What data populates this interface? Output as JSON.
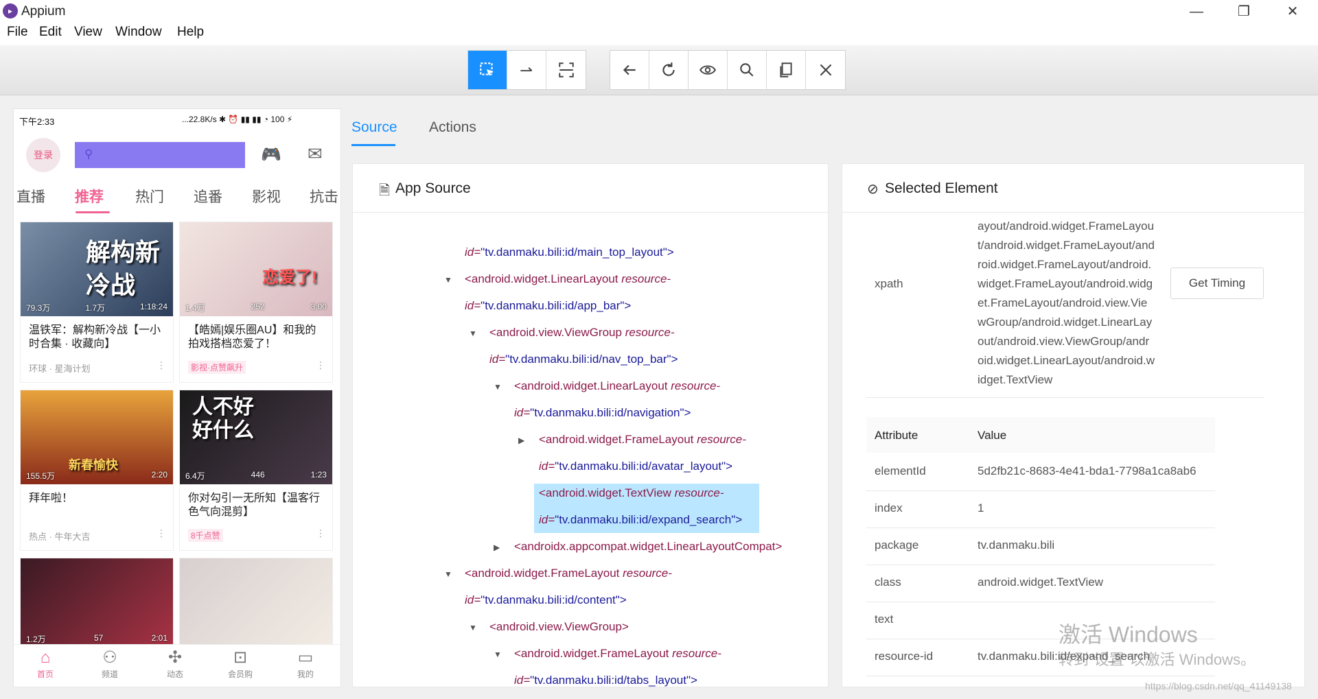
{
  "window": {
    "app_title": "Appium",
    "minimize": "—",
    "maximize": "❐",
    "close": "✕"
  },
  "menu": [
    "File",
    "Edit",
    "View",
    "Window",
    "Help"
  ],
  "toolbar": {
    "group1": [
      "select-element-icon",
      "swipe-icon",
      "screenshot-mode-icon"
    ],
    "group2": [
      "back-icon",
      "refresh-icon",
      "eye-icon",
      "search-icon",
      "copy-icon",
      "quit-icon"
    ]
  },
  "phone": {
    "status_time": "下午2:33",
    "status_right": "...22.8K/s ✱ ⏰ ▮▮ ▮▮ ◔ 100 ⚡",
    "login": "登录",
    "tabs": [
      "直播",
      "推荐",
      "热门",
      "追番",
      "影视",
      "抗击"
    ],
    "active_tab": 1,
    "cards": [
      {
        "title": "温铁军：解构新冷战【一小时合集 · 收藏向】",
        "views": "79.3万",
        "danmaku": "1.7万",
        "duration": "1:18:24",
        "sub": "环球 · 星海计划",
        "overlay": "解构新冷战",
        "badge": ""
      },
      {
        "title": "【皓嫣|娱乐圈AU】和我的拍戏搭档恋爱了！",
        "views": "1.4万",
        "danmaku": "252",
        "duration": "3:00",
        "sub": "",
        "overlay": "恋爱了!",
        "badge": "影视·点赞飙升"
      },
      {
        "title": "拜年啦！",
        "views": "155.5万",
        "danmaku": "",
        "duration": "2:20",
        "sub": "热点 · 牛年大吉",
        "overlay": "新春愉快",
        "badge": ""
      },
      {
        "title": "你对勾引一无所知【温客行色气向混剪】",
        "views": "6.4万",
        "danmaku": "446",
        "duration": "1:23",
        "sub": "",
        "overlay": "人不好 好什么",
        "badge": "8千点赞"
      },
      {
        "title": "",
        "views": "1.2万",
        "danmaku": "57",
        "duration": "2:01",
        "sub": "",
        "overlay": "",
        "badge": ""
      },
      {
        "title": "",
        "views": "",
        "danmaku": "",
        "duration": "",
        "sub": "",
        "overlay": "",
        "badge": ""
      }
    ],
    "bottom_nav": [
      "首页",
      "频道",
      "动态",
      "会员购",
      "我的"
    ]
  },
  "tabs": {
    "source": "Source",
    "actions": "Actions"
  },
  "app_source": {
    "title": "App Source",
    "lines": [
      {
        "indent": 0,
        "caret": "",
        "tag": "",
        "attr": "",
        "id_prefix": "id=",
        "id_val": "\"tv.danmaku.bili:id/main_top_layout\">",
        "part": "second"
      },
      {
        "indent": 0,
        "caret": "▼",
        "tag": "<android.widget.LinearLayout",
        "attr": "resource-",
        "part": "first"
      },
      {
        "indent": 0,
        "caret": "",
        "id_prefix": "id=",
        "id_val": "\"tv.danmaku.bili:id/app_bar\">",
        "part": "second"
      },
      {
        "indent": 1,
        "caret": "▼",
        "tag": "<android.view.ViewGroup",
        "attr": "resource-",
        "part": "first"
      },
      {
        "indent": 1,
        "caret": "",
        "id_prefix": "id=",
        "id_val": "\"tv.danmaku.bili:id/nav_top_bar\">",
        "part": "second"
      },
      {
        "indent": 2,
        "caret": "▼",
        "tag": "<android.widget.LinearLayout",
        "attr": "resource-",
        "part": "first"
      },
      {
        "indent": 2,
        "caret": "",
        "id_prefix": "id=",
        "id_val": "\"tv.danmaku.bili:id/navigation\">",
        "part": "second"
      },
      {
        "indent": 3,
        "caret": "▶",
        "tag": "<android.widget.FrameLayout",
        "attr": "resource-",
        "part": "first"
      },
      {
        "indent": 3,
        "caret": "",
        "id_prefix": "id=",
        "id_val": "\"tv.danmaku.bili:id/avatar_layout\">",
        "part": "second"
      },
      {
        "indent": 3,
        "caret": "",
        "tag": "<android.widget.TextView",
        "attr": "resource-",
        "part": "first"
      },
      {
        "indent": 3,
        "caret": "",
        "id_prefix": "id=",
        "id_val": "\"tv.danmaku.bili:id/expand_search\">",
        "part": "second"
      },
      {
        "indent": 2,
        "caret": "▶",
        "tag": "<androidx.appcompat.widget.LinearLayoutCompat>",
        "attr": "",
        "part": "first"
      },
      {
        "indent": 0,
        "caret": "▼",
        "tag": "<android.widget.FrameLayout",
        "attr": "resource-",
        "part": "first"
      },
      {
        "indent": 0,
        "caret": "",
        "id_prefix": "id=",
        "id_val": "\"tv.danmaku.bili:id/content\">",
        "part": "second"
      },
      {
        "indent": 1,
        "caret": "▼",
        "tag": "<android.view.ViewGroup>",
        "attr": "",
        "part": "first"
      },
      {
        "indent": 2,
        "caret": "▼",
        "tag": "<android.widget.FrameLayout",
        "attr": "resource-",
        "part": "first"
      },
      {
        "indent": 2,
        "caret": "",
        "id_prefix": "id=",
        "id_val": "\"tv.danmaku.bili:id/tabs_layout\">",
        "part": "second"
      }
    ]
  },
  "selected": {
    "title": "Selected Element",
    "xpath_label": "xpath",
    "xpath_value": "ayout/android.widget.FrameLayout/android.widget.FrameLayout/android.widget.FrameLayout/android.widget.FrameLayout/android.widget.FrameLayout/android.view.ViewGroup/android.widget.LinearLayout/android.view.ViewGroup/android.widget.LinearLayout/android.widget.TextView",
    "get_timing": "Get Timing",
    "header_attr": "Attribute",
    "header_value": "Value",
    "rows": [
      {
        "attr": "elementId",
        "value": "5d2fb21c-8683-4e41-bda1-7798a1ca8ab6"
      },
      {
        "attr": "index",
        "value": "1"
      },
      {
        "attr": "package",
        "value": "tv.danmaku.bili"
      },
      {
        "attr": "class",
        "value": "android.widget.TextView"
      },
      {
        "attr": "text",
        "value": ""
      },
      {
        "attr": "resource-id",
        "value": "tv.danmaku.bili:id/expand_search"
      }
    ]
  },
  "watermark": {
    "line1": "激活 Windows",
    "line2": "转到\"设置\"以激活 Windows。",
    "url": "https://blog.csdn.net/qq_41149138"
  },
  "colors": {
    "accent": "#1890ff",
    "tag": "#8b1a4a",
    "pink": "#f06292",
    "highlight": "#bae7ff"
  }
}
